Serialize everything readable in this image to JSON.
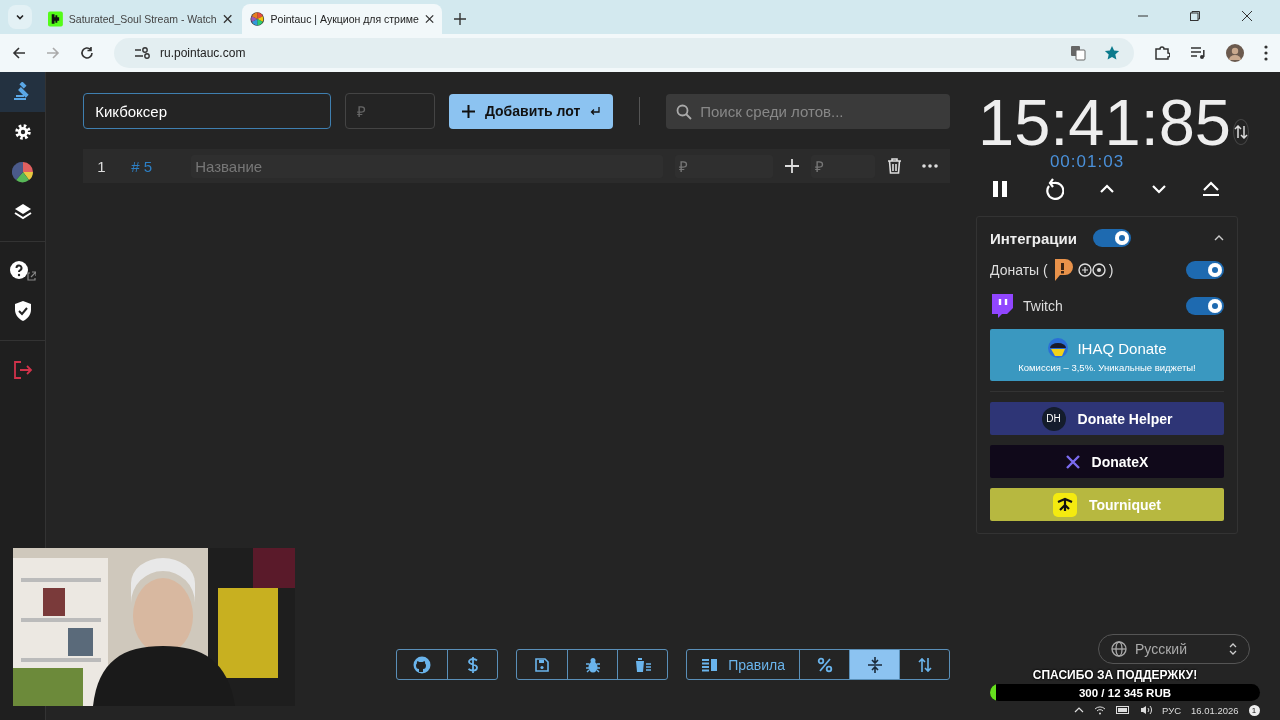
{
  "browser": {
    "tabs": [
      {
        "title": "Saturated_Soul Stream - Watch",
        "selected": false
      },
      {
        "title": "Pointauc | Аукцион для стриме",
        "selected": true
      }
    ],
    "url": "ru.pointauc.com"
  },
  "sidebar": {
    "items": [
      {
        "kind": "gavel",
        "selected": true
      },
      {
        "kind": "settings",
        "selected": false
      },
      {
        "kind": "chart",
        "selected": false
      },
      {
        "kind": "layers",
        "selected": false
      },
      {
        "kind": "help",
        "selected": false
      },
      {
        "kind": "shield",
        "selected": false
      },
      {
        "kind": "logout",
        "selected": false
      }
    ]
  },
  "toolbar": {
    "lot_name": "Кикбоксер",
    "amount_placeholder": "₽",
    "add_button": "Добавить лот",
    "search_placeholder": "Поиск среди лотов..."
  },
  "lots": [
    {
      "index": "1",
      "id": "# 5",
      "name_placeholder": "Название",
      "amount_placeholder": "₽",
      "add_placeholder": "₽"
    }
  ],
  "timer": {
    "time": "15:41:85",
    "elapsed": "00:01:03"
  },
  "integrations": {
    "title": "Интеграции",
    "on": true,
    "expanded": true,
    "items": [
      {
        "kind": "donations",
        "label": "Донаты (",
        "suffix": ")",
        "on": true
      },
      {
        "kind": "twitch",
        "label": "Twitch",
        "on": true
      }
    ],
    "promos": [
      {
        "kind": "ihaq",
        "title": "IHAQ Donate",
        "subtitle": "Комиссия – 3,5%. Уникальные виджеты!"
      },
      {
        "kind": "dh",
        "title": "Donate Helper",
        "logo": "DH"
      },
      {
        "kind": "donatex",
        "title": "DonateX"
      },
      {
        "kind": "tourniquet",
        "title": "Tourniquet"
      }
    ]
  },
  "bottom_toolbar": {
    "groups": [
      [
        {
          "kind": "github",
          "selected": false
        },
        {
          "kind": "dollar",
          "selected": false
        }
      ],
      [
        {
          "kind": "save",
          "selected": false
        },
        {
          "kind": "bug",
          "selected": false
        },
        {
          "kind": "clear",
          "selected": false
        }
      ],
      [
        {
          "kind": "rules",
          "label": "Правила",
          "selected": false
        },
        {
          "kind": "percent",
          "selected": false
        },
        {
          "kind": "compact",
          "selected": true
        },
        {
          "kind": "sort",
          "selected": false
        }
      ]
    ]
  },
  "language": "Русский",
  "goal": {
    "title": "СПАСИБО ЗА ПОДДЕРЖКУ!",
    "amount": "300 / 12 345 RUB",
    "level": 0.02
  },
  "taskbar": {
    "lang": "РУС",
    "date": "16.01.2026",
    "notifications": "1"
  }
}
